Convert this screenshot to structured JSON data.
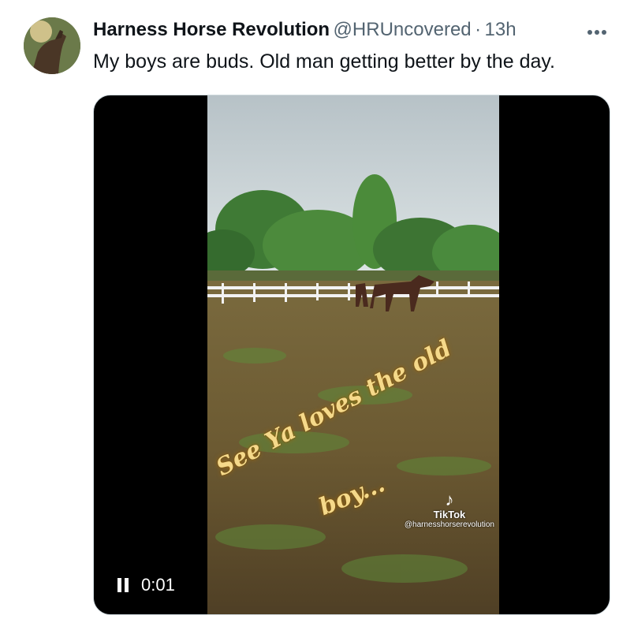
{
  "tweet": {
    "author_name": "Harness Horse Revolution",
    "handle": "@HRUncovered",
    "separator": "·",
    "time": "13h",
    "more_icon": "more-horizontal-icon",
    "text": "My boys are buds. Old man getting better by the day."
  },
  "video": {
    "caption_line1": "See Ya loves the old",
    "caption_line2": "boy...",
    "watermark_brand": "TikTok",
    "watermark_handle": "@harnesshorserevolution",
    "play_state_icon": "pause-icon",
    "timecode": "0:01"
  },
  "colors": {
    "text_primary": "#0f1419",
    "text_secondary": "#536471",
    "caption": "#f5d98a"
  }
}
